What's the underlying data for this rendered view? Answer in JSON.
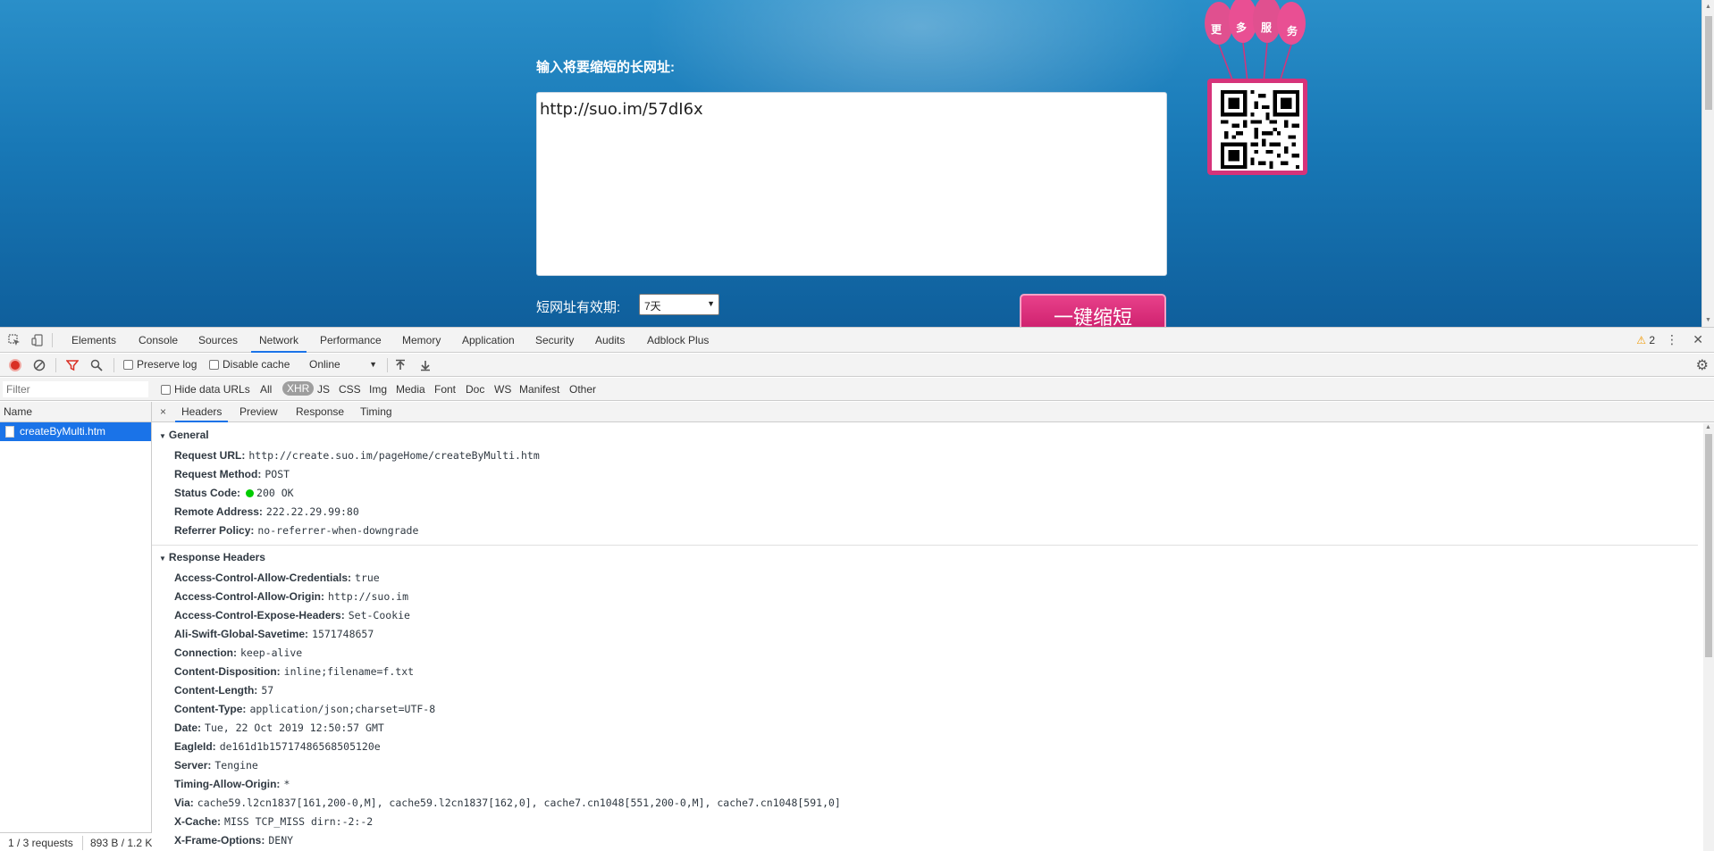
{
  "page": {
    "form_label": "输入将要缩短的长网址:",
    "long_url_value": "http://suo.im/57dI6x",
    "validity_label": "短网址有效期:",
    "validity_selected": "7天",
    "shorten_button": "一键缩短",
    "balloon_chars": [
      "更",
      "多",
      "服",
      "务"
    ]
  },
  "devtools": {
    "tabs": [
      "Elements",
      "Console",
      "Sources",
      "Network",
      "Performance",
      "Memory",
      "Application",
      "Security",
      "Audits",
      "Adblock Plus"
    ],
    "active_tab": "Network",
    "warning_count": "2",
    "toolbar": {
      "preserve_log": "Preserve log",
      "disable_cache": "Disable cache",
      "throttling": "Online"
    },
    "filter": {
      "placeholder": "Filter",
      "hide_data_urls": "Hide data URLs",
      "types": [
        "All",
        "XHR",
        "JS",
        "CSS",
        "Img",
        "Media",
        "Font",
        "Doc",
        "WS",
        "Manifest",
        "Other"
      ],
      "active_type": "XHR"
    },
    "requests": {
      "column_header": "Name",
      "items": [
        "createByMulti.htm"
      ],
      "summary_count": "1 / 3 requests",
      "summary_size": "893 B / 1.2 KB"
    },
    "detail": {
      "tabs": [
        "Headers",
        "Preview",
        "Response",
        "Timing"
      ],
      "active_tab": "Headers",
      "close": "×",
      "general_title": "General",
      "general": [
        {
          "key": "Request URL:",
          "value": "http://create.suo.im/pageHome/createByMulti.htm"
        },
        {
          "key": "Request Method:",
          "value": "POST"
        },
        {
          "key": "Status Code:",
          "value": "200 OK"
        },
        {
          "key": "Remote Address:",
          "value": "222.22.29.99:80"
        },
        {
          "key": "Referrer Policy:",
          "value": "no-referrer-when-downgrade"
        }
      ],
      "response_title": "Response Headers",
      "response": [
        {
          "key": "Access-Control-Allow-Credentials:",
          "value": "true"
        },
        {
          "key": "Access-Control-Allow-Origin:",
          "value": "http://suo.im"
        },
        {
          "key": "Access-Control-Expose-Headers:",
          "value": "Set-Cookie"
        },
        {
          "key": "Ali-Swift-Global-Savetime:",
          "value": "1571748657"
        },
        {
          "key": "Connection:",
          "value": "keep-alive"
        },
        {
          "key": "Content-Disposition:",
          "value": "inline;filename=f.txt"
        },
        {
          "key": "Content-Length:",
          "value": "57"
        },
        {
          "key": "Content-Type:",
          "value": "application/json;charset=UTF-8"
        },
        {
          "key": "Date:",
          "value": "Tue, 22 Oct 2019 12:50:57 GMT"
        },
        {
          "key": "EagleId:",
          "value": "de161d1b15717486568505120e"
        },
        {
          "key": "Server:",
          "value": "Tengine"
        },
        {
          "key": "Timing-Allow-Origin:",
          "value": "*"
        },
        {
          "key": "Via:",
          "value": "cache59.l2cn1837[161,200-0,M], cache59.l2cn1837[162,0], cache7.cn1048[551,200-0,M], cache7.cn1048[591,0]"
        },
        {
          "key": "X-Cache:",
          "value": "MISS TCP_MISS dirn:-2:-2"
        },
        {
          "key": "X-Frame-Options:",
          "value": "DENY"
        }
      ]
    }
  },
  "colors": {
    "page_blue": "#1878b6",
    "button_pink": "#cc1e6c",
    "devtools_accent": "#1a73e8",
    "status_green": "#00cc00"
  }
}
